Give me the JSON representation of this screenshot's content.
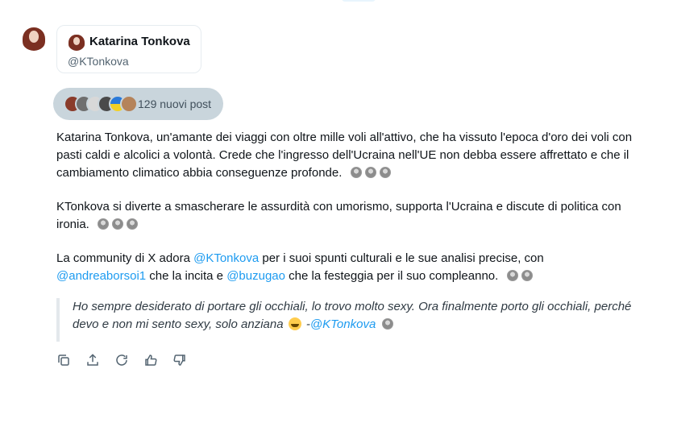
{
  "profile": {
    "name": "Katarina Tonkova",
    "handle": "@KTonkova"
  },
  "new_posts": {
    "label": "129 nuovi post"
  },
  "summary": {
    "p1": "Katarina Tonkova, un'amante dei viaggi con oltre mille voli all'attivo, che ha vissuto l'epoca d'oro dei voli con pasti caldi e alcolici a volontà. Crede che l'ingresso dell'Ucraina nell'UE non debba essere affrettato e che il cambiamento climatico abbia conseguenze profonde.",
    "p2": "KTonkova si diverte a smascherare le assurdità con umorismo, supporta l'Ucraina e discute di politica con ironia.",
    "p3_a": "La community di X adora ",
    "p3_link1": "@KTonkova",
    "p3_b": " per i suoi spunti culturali e le sue analisi precise, con ",
    "p3_link2": "@andreaborsoi1",
    "p3_c": " che la incita e ",
    "p3_link3": "@buzugao",
    "p3_d": " che la festeggia per il suo compleanno."
  },
  "quote": {
    "text": "Ho sempre desiderato di portare gli occhiali, lo trovo molto sexy. Ora finalmente porto gli occhiali, perché devo e non mi sento sexy, solo anziana",
    "dash": " -",
    "author": "@KTonkova"
  },
  "actions": [
    "copy-icon",
    "share-icon",
    "regenerate-icon",
    "thumbs-up-icon",
    "thumbs-down-icon"
  ],
  "colors": {
    "link": "#1d9bf0",
    "pill_bg": "#c9d5dc"
  }
}
